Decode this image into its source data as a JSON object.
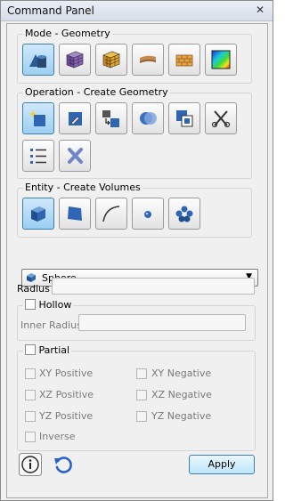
{
  "window": {
    "title": "Command Panel",
    "close_glyph": "✕"
  },
  "mode_group": {
    "title": "Mode - Geometry",
    "buttons": [
      {
        "name": "geometry-mode-icon",
        "active": true
      },
      {
        "name": "mesh-mode-icon"
      },
      {
        "name": "boundary-conditions-icon"
      },
      {
        "name": "material-icon"
      },
      {
        "name": "blocks-icon"
      },
      {
        "name": "results-icon"
      }
    ]
  },
  "operation_group": {
    "title": "Operation - Create Geometry",
    "buttons": [
      {
        "name": "create-geometry-icon",
        "active": true
      },
      {
        "name": "modify-geometry-icon"
      },
      {
        "name": "transform-icon"
      },
      {
        "name": "boolean-icon"
      },
      {
        "name": "copy-icon"
      },
      {
        "name": "decompose-icon"
      },
      {
        "name": "list-icon"
      },
      {
        "name": "delete-icon"
      }
    ]
  },
  "entity_group": {
    "title": "Entity - Create Volumes",
    "buttons": [
      {
        "name": "volume-icon",
        "active": true
      },
      {
        "name": "surface-icon"
      },
      {
        "name": "curve-icon"
      },
      {
        "name": "vertex-icon"
      },
      {
        "name": "group-icon"
      }
    ]
  },
  "shape_select": {
    "value": "Sphere",
    "arrow": "▼"
  },
  "radius": {
    "label": "Radius",
    "value": ""
  },
  "hollow": {
    "label": "Hollow",
    "checked": false,
    "inner_radius_label": "Inner Radius",
    "inner_radius_value": ""
  },
  "partial": {
    "label": "Partial",
    "checked": false,
    "options": {
      "xy_positive": "XY Positive",
      "xy_negative": "XY Negative",
      "xz_positive": "XZ Positive",
      "xz_negative": "XZ Negative",
      "yz_positive": "YZ Positive",
      "yz_negative": "YZ Negative",
      "inverse": "Inverse"
    }
  },
  "footer": {
    "apply_label": "Apply",
    "info_icon": "info-icon",
    "reset_icon": "reset-icon"
  },
  "colors": {
    "active_button": "#9ccff2",
    "accent": "#3c7fb1"
  }
}
